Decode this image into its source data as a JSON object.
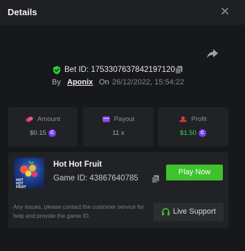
{
  "header": {
    "title": "Details",
    "close_icon": "close-icon"
  },
  "bet": {
    "bet_id_label": "Bet ID: 1753307637842197120",
    "by_label": "By",
    "username": "Aponix",
    "on_label": "On",
    "datetime": "26/12/2022, 15:54:22"
  },
  "stats": {
    "amount": {
      "label": "Amount",
      "value": "$0.15",
      "icon": "coins-icon",
      "color": "#e2356a"
    },
    "payout": {
      "label": "Payout",
      "value": "11 x",
      "icon": "wallet-icon",
      "color": "#8a4df0"
    },
    "profit": {
      "label": "Profit",
      "value": "$1.50",
      "icon": "money-icon",
      "color": "#e63b3b",
      "value_color": "#45d24a"
    }
  },
  "coin_symbol": "C",
  "game": {
    "name": "Hot Hot Fruit",
    "game_id": "Game ID: 43867640785",
    "thumb_text": "HOT HOT FRUIT",
    "play_label": "Play Now",
    "issue_text": "Any issues, please contact the customer service for help and provide the game ID.",
    "support_label": "Live Support"
  },
  "colors": {
    "accent_green": "#3fc22d",
    "coin_purple": "#7a3cf0",
    "shield_green": "#2bcf3d"
  }
}
